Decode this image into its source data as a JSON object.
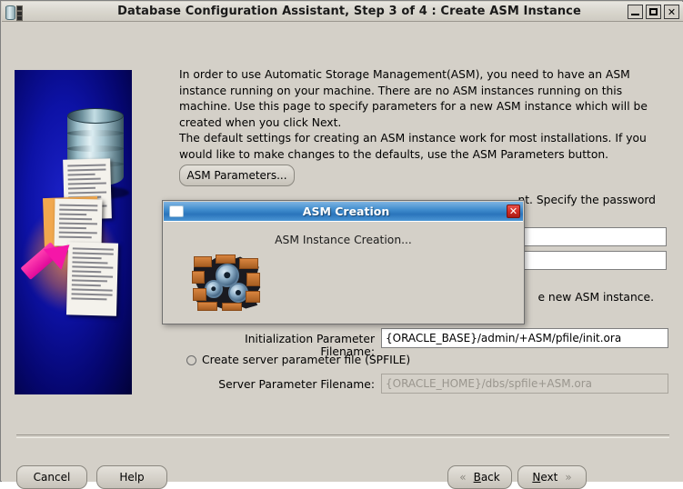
{
  "window": {
    "title": "Database Configuration Assistant, Step 3 of 4 : Create ASM Instance",
    "icon": "database-icon",
    "controls": {
      "minimize": "minimize-button",
      "maximize": "maximize-button",
      "close_label": "✕"
    }
  },
  "main": {
    "paragraph_1": "In order to use Automatic Storage Management(ASM), you need to have an ASM instance running on your machine. There are no ASM instances running on this machine. Use this page to specify parameters for a new ASM instance which will be created when you click Next.",
    "paragraph_2": "The default settings for creating an ASM instance work for most installations. If you would like to make changes to the defaults, use the ASM Parameters button.",
    "asm_parameters_button": "ASM Parameters...",
    "paragraph_3_visible_tail": "nt. Specify the password",
    "paragraph_4_visible_tail": "e new ASM instance.",
    "password_field_1": "",
    "password_field_2": "",
    "init_param_label": "Initialization Parameter Filename:",
    "init_param_value": "{ORACLE_BASE}/admin/+ASM/pfile/init.ora",
    "spfile_radio_label": "Create server parameter file (SPFILE)",
    "spfile_radio_checked": false,
    "server_param_label": "Server Parameter Filename:",
    "server_param_value": "{ORACLE_HOME}/dbs/spfile+ASM.ora",
    "server_param_disabled": true
  },
  "footer": {
    "cancel": "Cancel",
    "help": "Help",
    "back_mnemonic": "B",
    "back_rest": "ack",
    "next_mnemonic": "N",
    "next_rest": "ext",
    "back_chevron": "«",
    "next_chevron": "»"
  },
  "dialog": {
    "title": "ASM Creation",
    "close_label": "✕",
    "message": "ASM Instance Creation...",
    "icon": "window-icon",
    "graphic": "gears-breaking-wall-icon"
  },
  "colors": {
    "face": "#d4d0c8",
    "dialog_title_blue": "#3f8ccd",
    "close_red": "#cf2b24",
    "panel_blue": "#0d12a6",
    "arrow_magenta": "#f516a8"
  }
}
